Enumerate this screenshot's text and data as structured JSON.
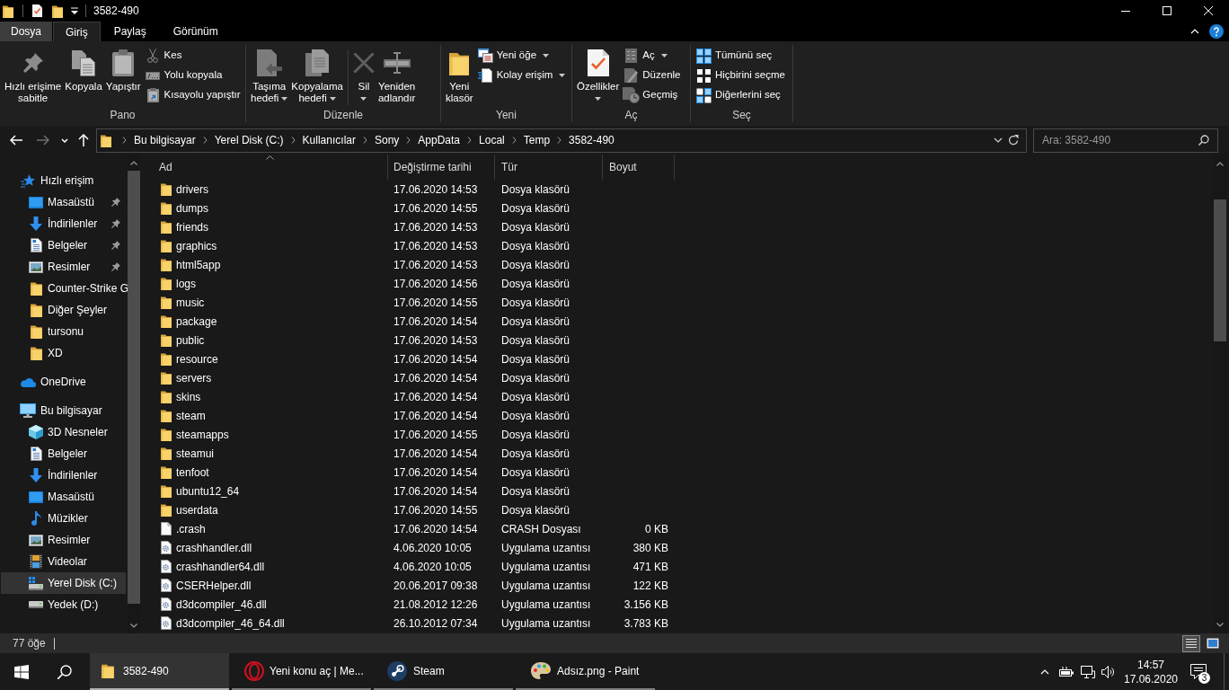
{
  "window": {
    "title": "3582-490"
  },
  "ribbon": {
    "tabs": [
      {
        "label": "Dosya",
        "kind": "menu",
        "selected": false
      },
      {
        "label": "Giriş",
        "kind": "tab",
        "selected": true
      },
      {
        "label": "Paylaş",
        "kind": "tab",
        "selected": false
      },
      {
        "label": "Görünüm",
        "kind": "tab",
        "selected": false
      }
    ],
    "groups": [
      {
        "label": "Pano",
        "sections": [
          {
            "large": [
              {
                "label": "Hızlı erişime sabitle",
                "dropdown": false
              },
              {
                "label": "Kopyala",
                "dropdown": false
              },
              {
                "label": "Yapıştır",
                "dropdown": false
              }
            ],
            "small": [
              {
                "label": "Kes",
                "dropdown": false
              },
              {
                "label": "Yolu kopyala",
                "dropdown": false
              },
              {
                "label": "Kısayolu yapıştır",
                "dropdown": false
              }
            ]
          }
        ]
      },
      {
        "label": "Düzenle",
        "sections": [
          {
            "large": [
              {
                "label": "Taşıma hedefi",
                "dropdown": true
              },
              {
                "label": "Kopyalama hedefi",
                "dropdown": true
              }
            ]
          },
          {
            "large": [
              {
                "label": "Sil",
                "dropdown": true
              },
              {
                "label": "Yeniden adlandır",
                "dropdown": false
              }
            ]
          }
        ]
      },
      {
        "label": "Yeni",
        "sections": [
          {
            "large": [
              {
                "label": "Yeni klasör",
                "dropdown": false
              }
            ],
            "small": [
              {
                "label": "Yeni öğe",
                "dropdown": true
              },
              {
                "label": "Kolay erişim",
                "dropdown": true
              }
            ]
          }
        ]
      },
      {
        "label": "Aç",
        "sections": [
          {
            "large": [
              {
                "label": "Özellikler",
                "dropdown": true
              }
            ],
            "small": [
              {
                "label": "Aç",
                "dropdown": true
              },
              {
                "label": "Düzenle",
                "dropdown": false
              },
              {
                "label": "Geçmiş",
                "dropdown": false
              }
            ]
          }
        ]
      },
      {
        "label": "Seç",
        "sections": [
          {
            "small": [
              {
                "label": "Tümünü seç",
                "dropdown": false
              },
              {
                "label": "Hiçbirini seçme",
                "dropdown": false
              },
              {
                "label": "Diğerlerini seç",
                "dropdown": false
              }
            ]
          }
        ]
      }
    ]
  },
  "navigation": {
    "back": {
      "disabled": false
    },
    "forward": {
      "disabled": true
    }
  },
  "address_bar": {
    "breadcrumbs": [
      "Bu bilgisayar",
      "Yerel Disk (C:)",
      "Kullanıcılar",
      "Sony",
      "AppData",
      "Local",
      "Temp",
      "3582-490"
    ]
  },
  "search": {
    "placeholder": "Ara: 3582-490"
  },
  "sidebar": {
    "items": [
      {
        "label": "Hızlı erişim",
        "kind": "quickaccess",
        "selected": false,
        "children": [
          {
            "label": "Masaüstü",
            "kind": "desktop",
            "selected": false,
            "pinned": true
          },
          {
            "label": "İndirilenler",
            "kind": "downloads",
            "selected": false,
            "pinned": true
          },
          {
            "label": "Belgeler",
            "kind": "documents",
            "selected": false,
            "pinned": true
          },
          {
            "label": "Resimler",
            "kind": "pictures",
            "selected": false,
            "pinned": true
          },
          {
            "label": "Counter-Strike G",
            "kind": "folder",
            "selected": false,
            "pinned": false
          },
          {
            "label": "Diğer Şeyler",
            "kind": "folder",
            "selected": false,
            "pinned": false
          },
          {
            "label": "tursonu",
            "kind": "folder",
            "selected": false,
            "pinned": false
          },
          {
            "label": "XD",
            "kind": "folder",
            "selected": false,
            "pinned": false
          }
        ]
      },
      {
        "label": "OneDrive",
        "kind": "onedrive",
        "selected": false
      },
      {
        "label": "Bu bilgisayar",
        "kind": "pc",
        "selected": false,
        "children": [
          {
            "label": "3D Nesneler",
            "kind": "objects",
            "selected": false
          },
          {
            "label": "Belgeler",
            "kind": "documents",
            "selected": false
          },
          {
            "label": "İndirilenler",
            "kind": "downloads",
            "selected": false
          },
          {
            "label": "Masaüstü",
            "kind": "desktop",
            "selected": false
          },
          {
            "label": "Müzikler",
            "kind": "music",
            "selected": false
          },
          {
            "label": "Resimler",
            "kind": "pictures",
            "selected": false
          },
          {
            "label": "Videolar",
            "kind": "videos",
            "selected": false
          },
          {
            "label": "Yerel Disk (C:)",
            "kind": "systemdrive",
            "selected": true
          },
          {
            "label": "Yedek (D:)",
            "kind": "drive",
            "selected": false
          }
        ]
      }
    ]
  },
  "file_list": {
    "columns": [
      {
        "label": "Ad",
        "sorted": true
      },
      {
        "label": "Değiştirme tarihi",
        "sorted": false
      },
      {
        "label": "Tür",
        "sorted": false
      },
      {
        "label": "Boyut",
        "sorted": false
      }
    ],
    "rows": [
      {
        "name": "drivers",
        "modified": "17.06.2020 14:53",
        "type": "Dosya klasörü",
        "kind": "folder"
      },
      {
        "name": "dumps",
        "modified": "17.06.2020 14:55",
        "type": "Dosya klasörü",
        "kind": "folder"
      },
      {
        "name": "friends",
        "modified": "17.06.2020 14:53",
        "type": "Dosya klasörü",
        "kind": "folder"
      },
      {
        "name": "graphics",
        "modified": "17.06.2020 14:53",
        "type": "Dosya klasörü",
        "kind": "folder"
      },
      {
        "name": "html5app",
        "modified": "17.06.2020 14:53",
        "type": "Dosya klasörü",
        "kind": "folder"
      },
      {
        "name": "logs",
        "modified": "17.06.2020 14:56",
        "type": "Dosya klasörü",
        "kind": "folder"
      },
      {
        "name": "music",
        "modified": "17.06.2020 14:55",
        "type": "Dosya klasörü",
        "kind": "folder"
      },
      {
        "name": "package",
        "modified": "17.06.2020 14:54",
        "type": "Dosya klasörü",
        "kind": "folder"
      },
      {
        "name": "public",
        "modified": "17.06.2020 14:53",
        "type": "Dosya klasörü",
        "kind": "folder"
      },
      {
        "name": "resource",
        "modified": "17.06.2020 14:54",
        "type": "Dosya klasörü",
        "kind": "folder"
      },
      {
        "name": "servers",
        "modified": "17.06.2020 14:54",
        "type": "Dosya klasörü",
        "kind": "folder"
      },
      {
        "name": "skins",
        "modified": "17.06.2020 14:54",
        "type": "Dosya klasörü",
        "kind": "folder"
      },
      {
        "name": "steam",
        "modified": "17.06.2020 14:54",
        "type": "Dosya klasörü",
        "kind": "folder"
      },
      {
        "name": "steamapps",
        "modified": "17.06.2020 14:55",
        "type": "Dosya klasörü",
        "kind": "folder"
      },
      {
        "name": "steamui",
        "modified": "17.06.2020 14:54",
        "type": "Dosya klasörü",
        "kind": "folder"
      },
      {
        "name": "tenfoot",
        "modified": "17.06.2020 14:54",
        "type": "Dosya klasörü",
        "kind": "folder"
      },
      {
        "name": "ubuntu12_64",
        "modified": "17.06.2020 14:54",
        "type": "Dosya klasörü",
        "kind": "folder"
      },
      {
        "name": "userdata",
        "modified": "17.06.2020 14:55",
        "type": "Dosya klasörü",
        "kind": "folder"
      },
      {
        "name": ".crash",
        "modified": "17.06.2020 14:54",
        "type": "CRASH Dosyası",
        "size": "0 KB",
        "kind": "file"
      },
      {
        "name": "crashhandler.dll",
        "modified": "4.06.2020 10:05",
        "type": "Uygulama uzantısı",
        "size": "380 KB",
        "kind": "dll"
      },
      {
        "name": "crashhandler64.dll",
        "modified": "4.06.2020 10:05",
        "type": "Uygulama uzantısı",
        "size": "471 KB",
        "kind": "dll"
      },
      {
        "name": "CSERHelper.dll",
        "modified": "20.06.2017 09:38",
        "type": "Uygulama uzantısı",
        "size": "122 KB",
        "kind": "dll"
      },
      {
        "name": "d3dcompiler_46.dll",
        "modified": "21.08.2012 12:26",
        "type": "Uygulama uzantısı",
        "size": "3.156 KB",
        "kind": "dll"
      },
      {
        "name": "d3dcompiler_46_64.dll",
        "modified": "26.10.2012 07:34",
        "type": "Uygulama uzantısı",
        "size": "3.783 KB",
        "kind": "dll"
      }
    ]
  },
  "status_bar": {
    "item_count": "77 öğe",
    "views": [
      {
        "selected": true
      },
      {
        "selected": false
      }
    ]
  },
  "taskbar": {
    "tasks": [
      {
        "label": "3582-490",
        "selected": true
      },
      {
        "label": "Yeni konu aç | Me...",
        "selected": false
      },
      {
        "label": "Steam",
        "selected": false
      },
      {
        "label": "Adsız.png - Paint",
        "selected": false
      }
    ],
    "clock": {
      "time": "14:57",
      "date": "17.06.2020"
    },
    "notification_count": "3"
  }
}
